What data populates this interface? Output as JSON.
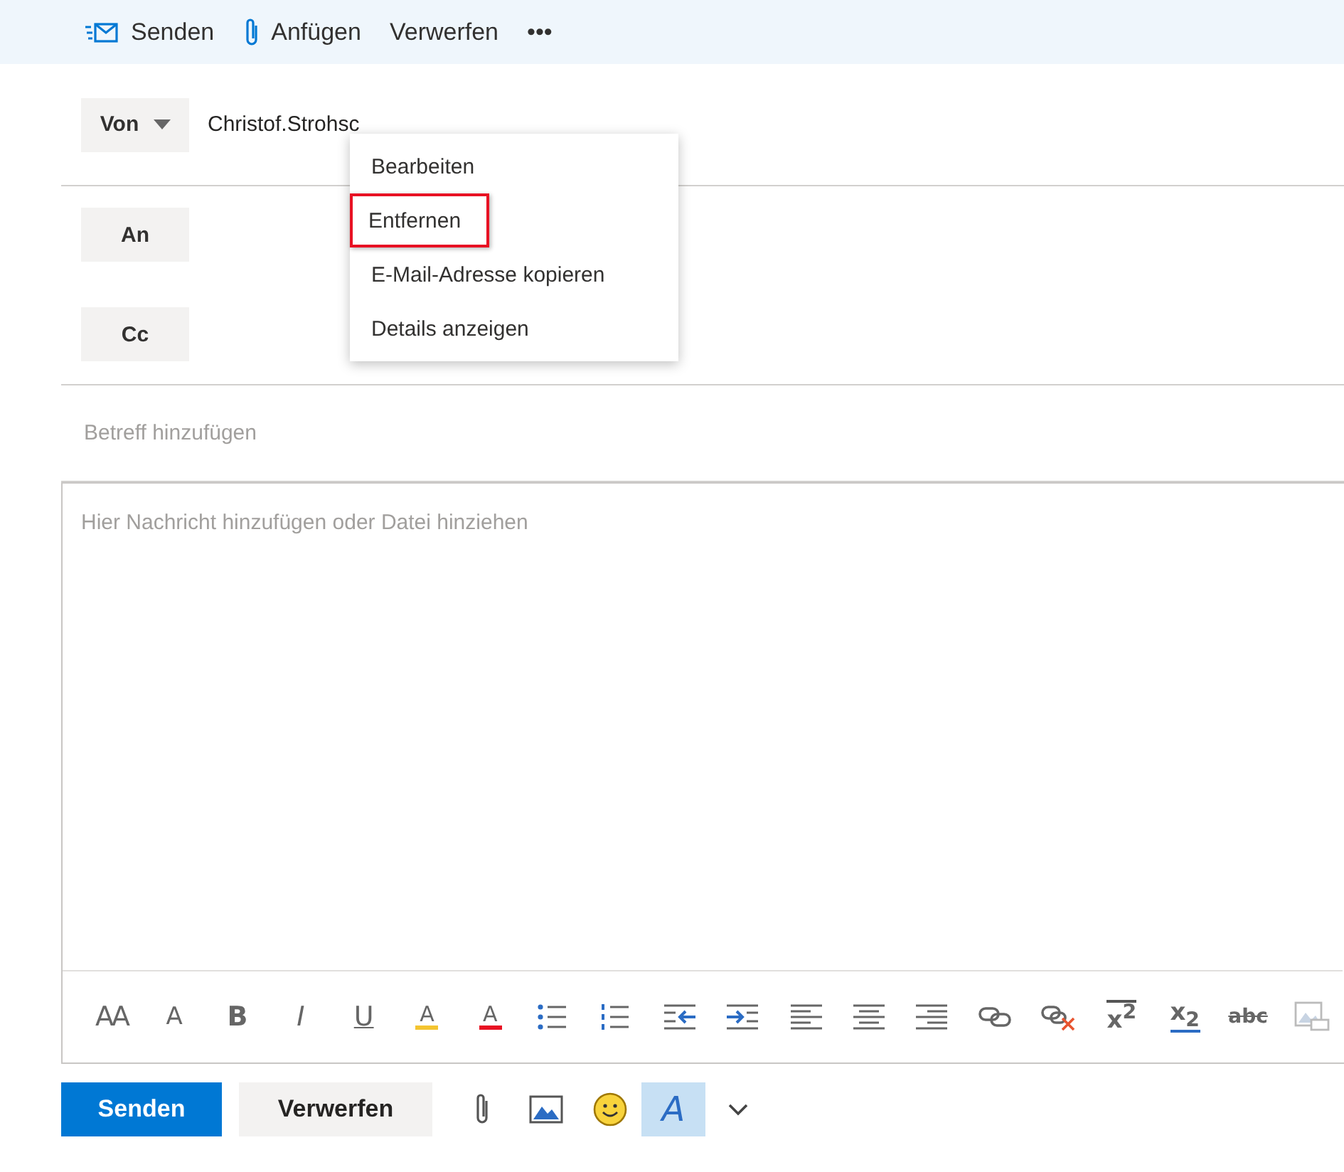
{
  "toolbar": [
    {
      "kind": "send",
      "label": "Senden"
    },
    {
      "kind": "attach",
      "label": "Anfügen"
    },
    {
      "kind": "plain",
      "label": "Verwerfen"
    },
    {
      "kind": "plain",
      "label": "•••"
    }
  ],
  "from": {
    "label": "Von",
    "value": "Christof.Strohsc"
  },
  "recipients": [
    {
      "label": "An"
    },
    {
      "label": "Cc"
    }
  ],
  "subject": {
    "placeholder": "Betreff hinzufügen"
  },
  "message": {
    "placeholder": "Hier Nachricht hinzufügen oder Datei hinziehen"
  },
  "context_menu": [
    {
      "label": "Bearbeiten",
      "selected": false
    },
    {
      "label": "Entfernen",
      "selected": true
    },
    {
      "label": "E-Mail-Adresse kopieren",
      "selected": false
    },
    {
      "label": "Details anzeigen",
      "selected": false
    }
  ],
  "format_tools": [
    {
      "kind": "font-size",
      "glyph": "AA"
    },
    {
      "kind": "grow",
      "glyph": "A"
    },
    {
      "kind": "bold",
      "glyph": "B"
    },
    {
      "kind": "italic",
      "glyph": "I"
    },
    {
      "kind": "underline",
      "glyph": "U"
    },
    {
      "kind": "highlight",
      "glyph": "A"
    },
    {
      "kind": "font-color",
      "glyph": "A"
    },
    {
      "kind": "bullets"
    },
    {
      "kind": "numbering"
    },
    {
      "kind": "outdent"
    },
    {
      "kind": "indent"
    },
    {
      "kind": "align-left"
    },
    {
      "kind": "align-center"
    },
    {
      "kind": "align-right"
    },
    {
      "kind": "link"
    },
    {
      "kind": "unlink"
    },
    {
      "kind": "superscript",
      "glyph": "x$^{2}$"
    },
    {
      "kind": "subscript",
      "glyph": "x$_{2}$"
    },
    {
      "kind": "strike",
      "glyph": "abc"
    },
    {
      "kind": "image"
    }
  ],
  "actions": [
    {
      "kind": "primary",
      "label": "Senden"
    },
    {
      "kind": "secondary",
      "label": "Verwerfen"
    }
  ],
  "action_icons": [
    {
      "kind": "attach",
      "selected": false
    },
    {
      "kind": "picture",
      "selected": false
    },
    {
      "kind": "emoji",
      "selected": false
    },
    {
      "kind": "format",
      "glyph": "A",
      "selected": true
    },
    {
      "kind": "more",
      "selected": false
    }
  ]
}
